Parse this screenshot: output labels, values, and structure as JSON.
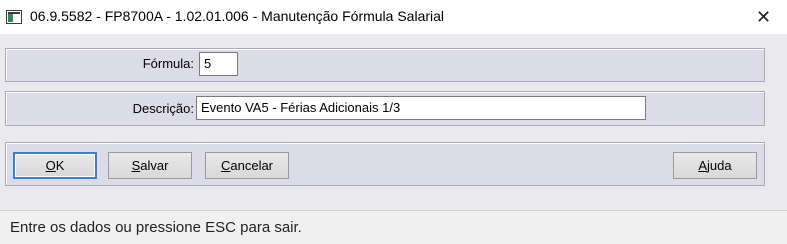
{
  "window": {
    "title": "06.9.5582 - FP8700A - 1.02.01.006 - Manutenção Fórmula Salarial",
    "close_glyph": "✕"
  },
  "form": {
    "formula_label": "Fórmula:",
    "formula_value": "5",
    "descricao_label": "Descrição:",
    "descricao_value": "Evento VA5 - Férias Adicionais 1/3"
  },
  "buttons": {
    "ok": {
      "mnemonic": "O",
      "rest": "K"
    },
    "salvar": {
      "mnemonic": "S",
      "rest": "alvar"
    },
    "cancelar": {
      "mnemonic": "C",
      "rest": "ancelar"
    },
    "ajuda": {
      "mnemonic": "A",
      "rest": "juda"
    }
  },
  "status": {
    "message": "Entre os dados ou pressione ESC para sair."
  }
}
